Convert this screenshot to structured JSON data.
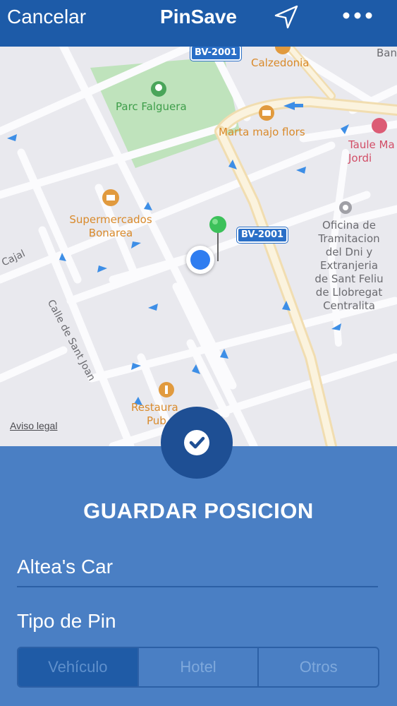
{
  "navbar": {
    "cancel_label": "Cancelar",
    "title": "PinSave",
    "location_icon": "location-arrow-icon",
    "more_icon": "more-dots-icon"
  },
  "map": {
    "poi_labels": {
      "park": "Parc Falguera",
      "calzedonia": "Calzedonia",
      "florist": "Marta majo flors",
      "supermarket_line1": "Supermercados",
      "supermarket_line2": "Bonarea",
      "office_line1": "Oficina de",
      "office_line2": "Tramitacion",
      "office_line3": "del Dni y",
      "office_line4": "Extranjeria",
      "office_line5": "de Sant Feliu",
      "office_line6": "de Llobregat",
      "office_line7": "Centralita",
      "taule_line1": "Taule Ma",
      "taule_line2": "Jordi",
      "restaurant_line1": "Restaura",
      "restaurant_line2": "Pub",
      "ban": "Ban"
    },
    "streets": {
      "calle_sant_joan": "Calle de Sant Joan",
      "cajal": "Cajal"
    },
    "road_shield": "BV-2001",
    "legal": "Aviso legal"
  },
  "panel": {
    "title": "GUARDAR POSICION",
    "name_value": "Altea's Car",
    "name_placeholder": "",
    "pin_type_label": "Tipo de Pin",
    "segments": [
      "Vehículo",
      "Hotel",
      "Otros"
    ],
    "selected_segment": "Vehículo"
  },
  "colors": {
    "navbar": "#1d5ba8",
    "panel": "#4a7fc4",
    "confirm": "#1e4f94",
    "user_dot": "#2f7df0",
    "pin": "#3cc15a"
  }
}
